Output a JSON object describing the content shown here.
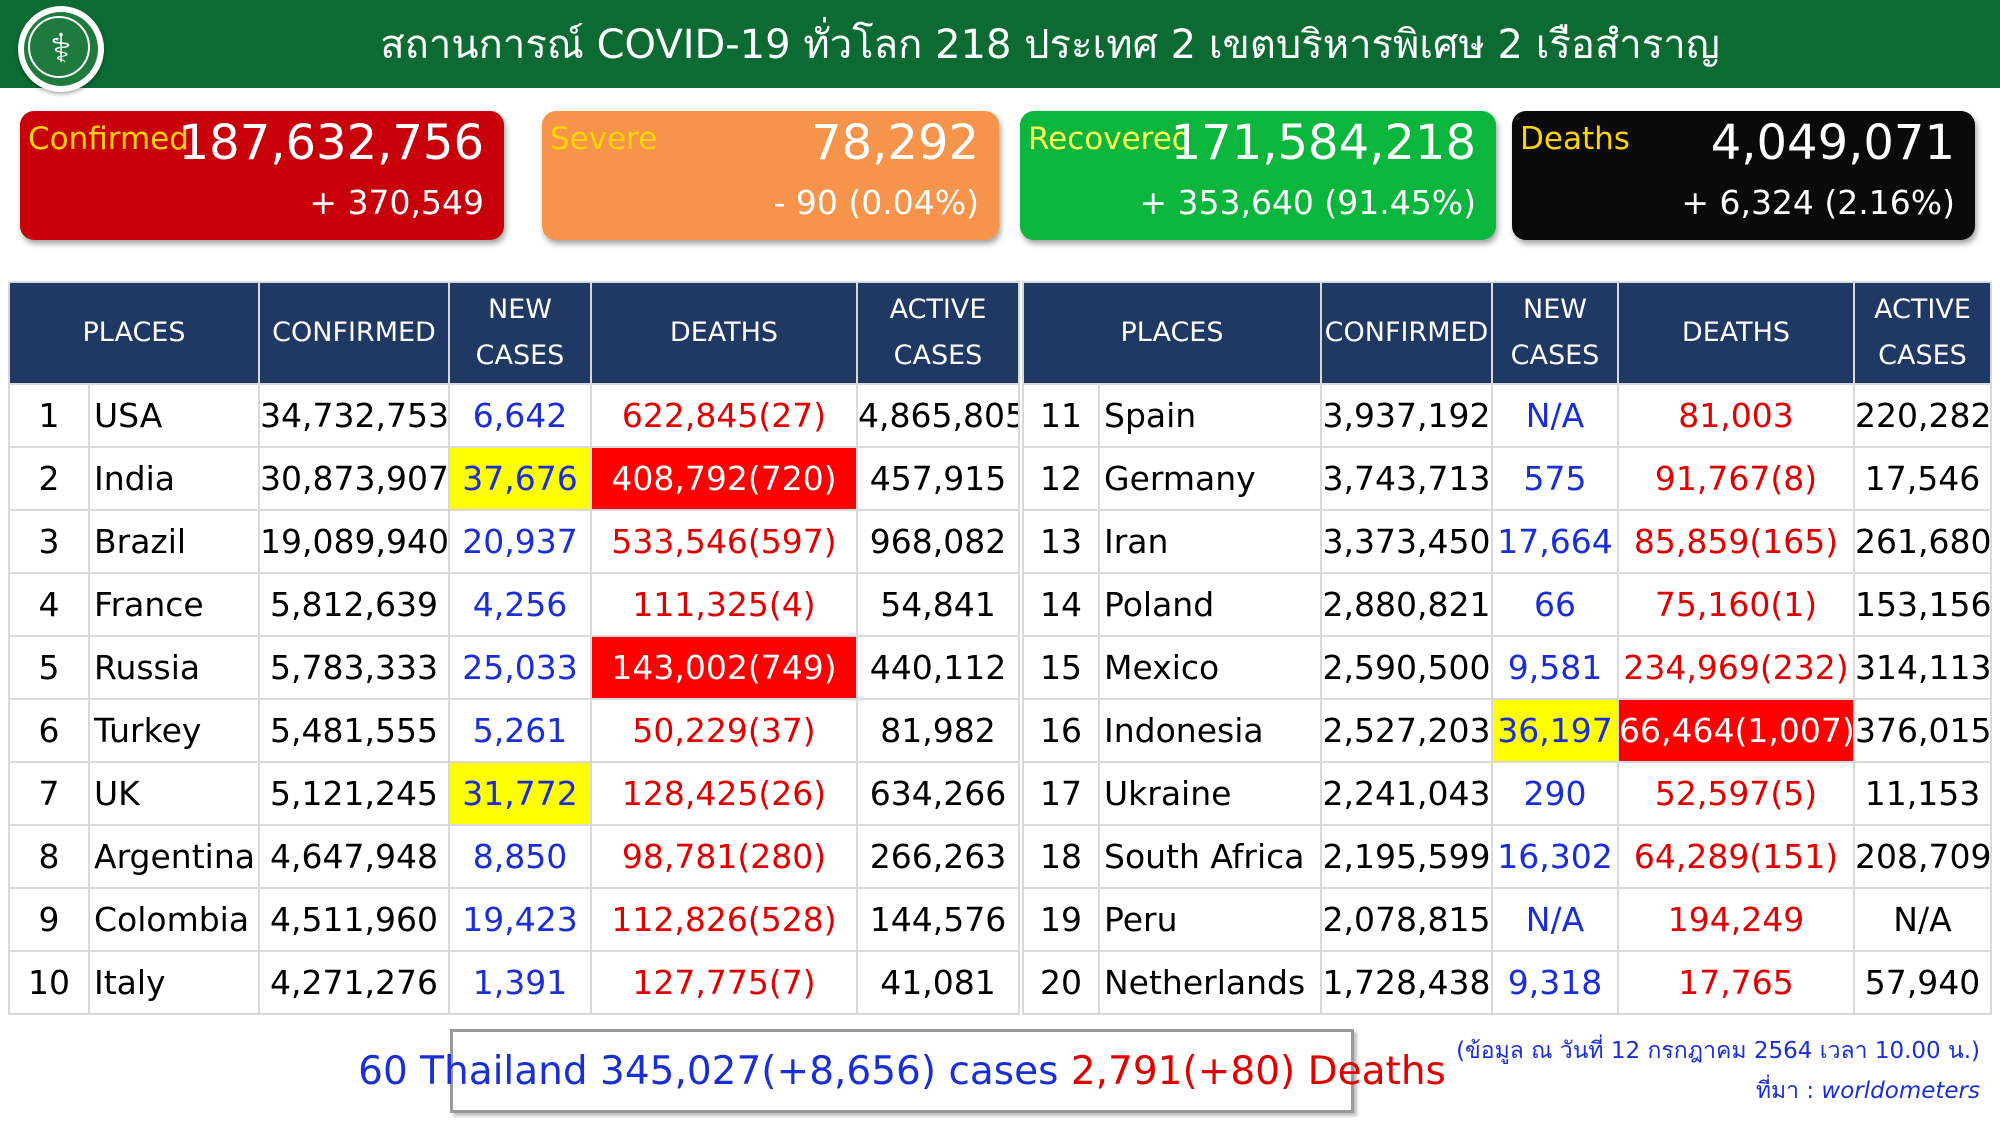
{
  "header": {
    "title": "สถานการณ์ COVID-19 ทั่วโลก 218 ประเทศ 2 เขตบริหารพิเศษ 2 เรือสำราญ",
    "logo_icon": "ministry-of-public-health-seal"
  },
  "cards": {
    "confirmed": {
      "label": "Confirmed",
      "value": "187,632,756",
      "change": "+ 370,549",
      "color": "#c8000a"
    },
    "severe": {
      "label": "Severe",
      "value": "78,292",
      "change": "- 90 (0.04%)",
      "color": "#f5944a"
    },
    "recovered": {
      "label": "Recovered",
      "value": "171,584,218",
      "change": "+ 353,640 (91.45%)",
      "color": "#0ab63c"
    },
    "deaths": {
      "label": "Deaths",
      "value": "4,049,071",
      "change": "+ 6,324 (2.16%)",
      "color": "#0a0a0a"
    }
  },
  "table_headers": {
    "places": "PLACES",
    "confirmed": "CONFIRMED",
    "new_cases_1": "NEW",
    "new_cases_2": "CASES",
    "deaths": "DEATHS",
    "active_cases_1": "ACTIVE",
    "active_cases_2": "CASES"
  },
  "rows_left": [
    {
      "rank": "1",
      "place": "USA",
      "confirmed": "34,732,753",
      "new_cases": "6,642",
      "deaths": "622,845(27)",
      "active": "4,865,805",
      "new_hl": "",
      "death_hl": ""
    },
    {
      "rank": "2",
      "place": "India",
      "confirmed": "30,873,907",
      "new_cases": "37,676",
      "deaths": "408,792(720)",
      "active": "457,915",
      "new_hl": "yellow",
      "death_hl": "red"
    },
    {
      "rank": "3",
      "place": "Brazil",
      "confirmed": "19,089,940",
      "new_cases": "20,937",
      "deaths": "533,546(597)",
      "active": "968,082",
      "new_hl": "",
      "death_hl": ""
    },
    {
      "rank": "4",
      "place": "France",
      "confirmed": "5,812,639",
      "new_cases": "4,256",
      "deaths": "111,325(4)",
      "active": "54,841",
      "new_hl": "",
      "death_hl": ""
    },
    {
      "rank": "5",
      "place": "Russia",
      "confirmed": "5,783,333",
      "new_cases": "25,033",
      "deaths": "143,002(749)",
      "active": "440,112",
      "new_hl": "",
      "death_hl": "red"
    },
    {
      "rank": "6",
      "place": "Turkey",
      "confirmed": "5,481,555",
      "new_cases": "5,261",
      "deaths": "50,229(37)",
      "active": "81,982",
      "new_hl": "",
      "death_hl": ""
    },
    {
      "rank": "7",
      "place": "UK",
      "confirmed": "5,121,245",
      "new_cases": "31,772",
      "deaths": "128,425(26)",
      "active": "634,266",
      "new_hl": "yellow",
      "death_hl": ""
    },
    {
      "rank": "8",
      "place": "Argentina",
      "confirmed": "4,647,948",
      "new_cases": "8,850",
      "deaths": "98,781(280)",
      "active": "266,263",
      "new_hl": "",
      "death_hl": ""
    },
    {
      "rank": "9",
      "place": "Colombia",
      "confirmed": "4,511,960",
      "new_cases": "19,423",
      "deaths": "112,826(528)",
      "active": "144,576",
      "new_hl": "",
      "death_hl": ""
    },
    {
      "rank": "10",
      "place": "Italy",
      "confirmed": "4,271,276",
      "new_cases": "1,391",
      "deaths": "127,775(7)",
      "active": "41,081",
      "new_hl": "",
      "death_hl": ""
    }
  ],
  "rows_right": [
    {
      "rank": "11",
      "place": "Spain",
      "confirmed": "3,937,192",
      "new_cases": "N/A",
      "deaths": "81,003",
      "active": "220,282",
      "new_hl": "",
      "death_hl": ""
    },
    {
      "rank": "12",
      "place": "Germany",
      "confirmed": "3,743,713",
      "new_cases": "575",
      "deaths": "91,767(8)",
      "active": "17,546",
      "new_hl": "",
      "death_hl": ""
    },
    {
      "rank": "13",
      "place": "Iran",
      "confirmed": "3,373,450",
      "new_cases": "17,664",
      "deaths": "85,859(165)",
      "active": "261,680",
      "new_hl": "",
      "death_hl": ""
    },
    {
      "rank": "14",
      "place": "Poland",
      "confirmed": "2,880,821",
      "new_cases": "66",
      "deaths": "75,160(1)",
      "active": "153,156",
      "new_hl": "",
      "death_hl": ""
    },
    {
      "rank": "15",
      "place": "Mexico",
      "confirmed": "2,590,500",
      "new_cases": "9,581",
      "deaths": "234,969(232)",
      "active": "314,113",
      "new_hl": "",
      "death_hl": ""
    },
    {
      "rank": "16",
      "place": "Indonesia",
      "confirmed": "2,527,203",
      "new_cases": "36,197",
      "deaths": "66,464(1,007)",
      "active": "376,015",
      "new_hl": "yellow",
      "death_hl": "red"
    },
    {
      "rank": "17",
      "place": "Ukraine",
      "confirmed": "2,241,043",
      "new_cases": "290",
      "deaths": "52,597(5)",
      "active": "11,153",
      "new_hl": "",
      "death_hl": ""
    },
    {
      "rank": "18",
      "place": "South Africa",
      "confirmed": "2,195,599",
      "new_cases": "16,302",
      "deaths": "64,289(151)",
      "active": "208,709",
      "new_hl": "",
      "death_hl": ""
    },
    {
      "rank": "19",
      "place": "Peru",
      "confirmed": "2,078,815",
      "new_cases": "N/A",
      "deaths": "194,249",
      "active": "N/A",
      "new_hl": "",
      "death_hl": ""
    },
    {
      "rank": "20",
      "place": "Netherlands",
      "confirmed": "1,728,438",
      "new_cases": "9,318",
      "deaths": "17,765",
      "active": "57,940",
      "new_hl": "",
      "death_hl": ""
    }
  ],
  "footer": {
    "thailand_cases": "60 Thailand 345,027(+8,656) cases",
    "thailand_deaths": "2,791(+80) Deaths",
    "date_note": "(ข้อมูล ณ วันที่ 12 กรกฎาคม 2564 เวลา 10.00 น.)",
    "source_prefix": "ที่มา : ",
    "source_name": "worldometers"
  }
}
